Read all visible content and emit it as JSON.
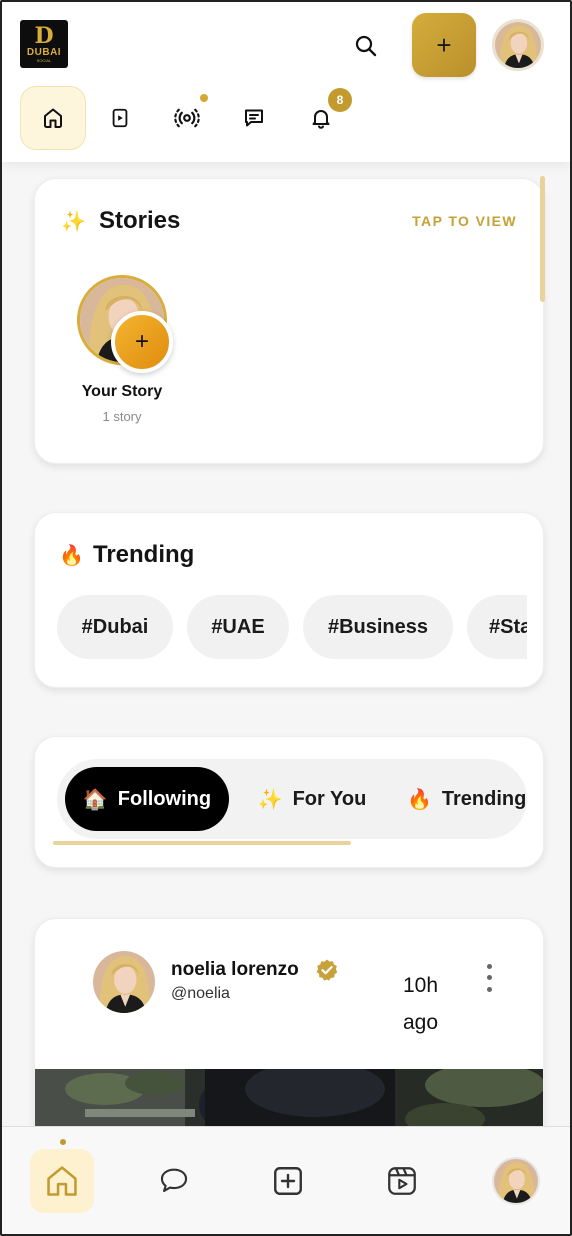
{
  "header": {
    "logo": {
      "mark": "D",
      "word": "DUBAI",
      "sub": "SOCIAL"
    },
    "create_label": "+",
    "nav": [
      {
        "icon": "home-icon",
        "active": true
      },
      {
        "icon": "video-icon"
      },
      {
        "icon": "live-icon",
        "dot": true
      },
      {
        "icon": "messages-icon"
      },
      {
        "icon": "notifications-icon",
        "badge": "8"
      }
    ]
  },
  "stories": {
    "emoji": "✨",
    "title": "Stories",
    "tap_label": "TAP TO VIEW",
    "items": [
      {
        "label": "Your Story",
        "count": "1 story",
        "add_label": "+"
      }
    ]
  },
  "trending": {
    "emoji": "🔥",
    "title": "Trending",
    "chips": [
      "#Dubai",
      "#UAE",
      "#Business",
      "#Sta"
    ]
  },
  "feed_tabs": [
    {
      "emoji": "🏠",
      "label": "Following",
      "active": true
    },
    {
      "emoji": "✨",
      "label": "For You"
    },
    {
      "emoji": "🔥",
      "label": "Trending"
    }
  ],
  "post": {
    "author": "noelia lorenzo",
    "handle": "@noelia",
    "time": "10h ago",
    "verified": true
  },
  "bottom_nav": [
    {
      "icon": "home-icon",
      "active": true
    },
    {
      "icon": "chat-icon"
    },
    {
      "icon": "create-icon"
    },
    {
      "icon": "reels-icon"
    },
    {
      "icon": "profile-avatar"
    }
  ],
  "colors": {
    "accent": "#d4ad3c",
    "accent_dark": "#b9902b",
    "active_bg": "#fdf5dc",
    "badge": "#c29a2e"
  }
}
